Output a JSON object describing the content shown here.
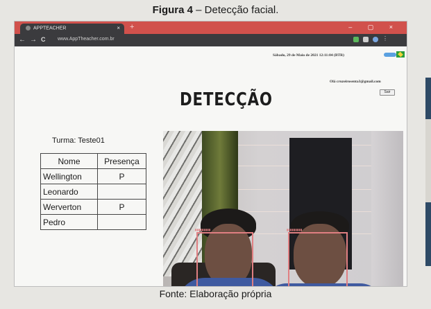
{
  "figure": {
    "label": "Figura 4",
    "caption": " – Detecção facial.",
    "source": "Fonte: Elaboração própria"
  },
  "browser": {
    "tab_title": "APPTEACHER",
    "tab_close": "×",
    "new_tab": "+",
    "window_controls": "– ▢ ×",
    "address": "www.AppTheacher.com.br",
    "back": "←",
    "forward": "→",
    "reload": "C"
  },
  "header": {
    "date_line": "Sábado, 29 de Maio de 2021     12:11:04 (BTR)",
    "user_email": "Olá cruzeirosenta3@gmail.com",
    "logout_label": "Sair",
    "title": "DETECÇÃO"
  },
  "class_info": {
    "label": "Turma: Teste01"
  },
  "attendance": {
    "headers": [
      "Nome",
      "Presença"
    ],
    "rows": [
      {
        "name": "Wellington",
        "presence": "P"
      },
      {
        "name": "Leonardo",
        "presence": ""
      },
      {
        "name": "Werverton",
        "presence": "P"
      },
      {
        "name": "Pedro",
        "presence": ""
      }
    ]
  },
  "colors": {
    "tab_bar": "#d1514c",
    "toolbar": "#3b3b3e",
    "face_box": "#e07f82"
  }
}
